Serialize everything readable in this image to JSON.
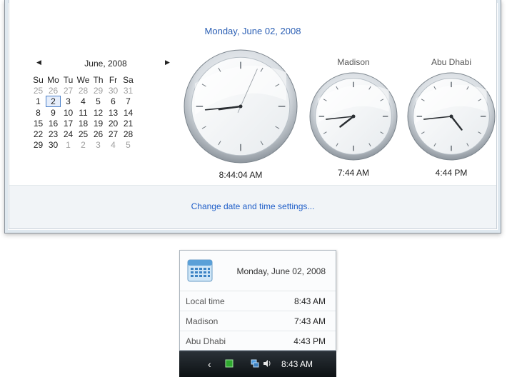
{
  "flyout": {
    "date_heading": "Monday, June 02, 2008",
    "calendar": {
      "month_title": "June, 2008",
      "weekdays": [
        "Su",
        "Mo",
        "Tu",
        "We",
        "Th",
        "Fr",
        "Sa"
      ],
      "weeks": [
        [
          "25",
          "26",
          "27",
          "28",
          "29",
          "30",
          "31"
        ],
        [
          "1",
          "2",
          "3",
          "4",
          "5",
          "6",
          "7"
        ],
        [
          "8",
          "9",
          "10",
          "11",
          "12",
          "13",
          "14"
        ],
        [
          "15",
          "16",
          "17",
          "18",
          "19",
          "20",
          "21"
        ],
        [
          "22",
          "23",
          "24",
          "25",
          "26",
          "27",
          "28"
        ],
        [
          "29",
          "30",
          "1",
          "2",
          "3",
          "4",
          "5"
        ]
      ],
      "selected_day": "2"
    },
    "clocks": [
      {
        "city": "",
        "time": "8:44:04 AM",
        "hour": 8,
        "minute": 44,
        "second": 4
      },
      {
        "city": "Madison",
        "time": "7:44 AM",
        "hour": 7,
        "minute": 44,
        "second": null
      },
      {
        "city": "Abu Dhabi",
        "time": "4:44 PM",
        "hour": 16,
        "minute": 44,
        "second": null
      }
    ],
    "change_link": "Change date and time settings..."
  },
  "popup": {
    "date": "Monday, June 02, 2008",
    "rows": [
      {
        "label": "Local time",
        "value": "8:43 AM"
      },
      {
        "label": "Madison",
        "value": "7:43 AM"
      },
      {
        "label": "Abu Dhabi",
        "value": "4:43 PM"
      }
    ]
  },
  "taskbar": {
    "time": "8:43 AM",
    "icons": [
      "show-hidden-icons-arrow",
      "green-status-icon",
      "network-icon",
      "speaker-icon"
    ]
  },
  "colors": {
    "accent_link": "#1f5ec8",
    "heading_blue": "#2b5fb4",
    "taskbar": "#1a2026"
  }
}
